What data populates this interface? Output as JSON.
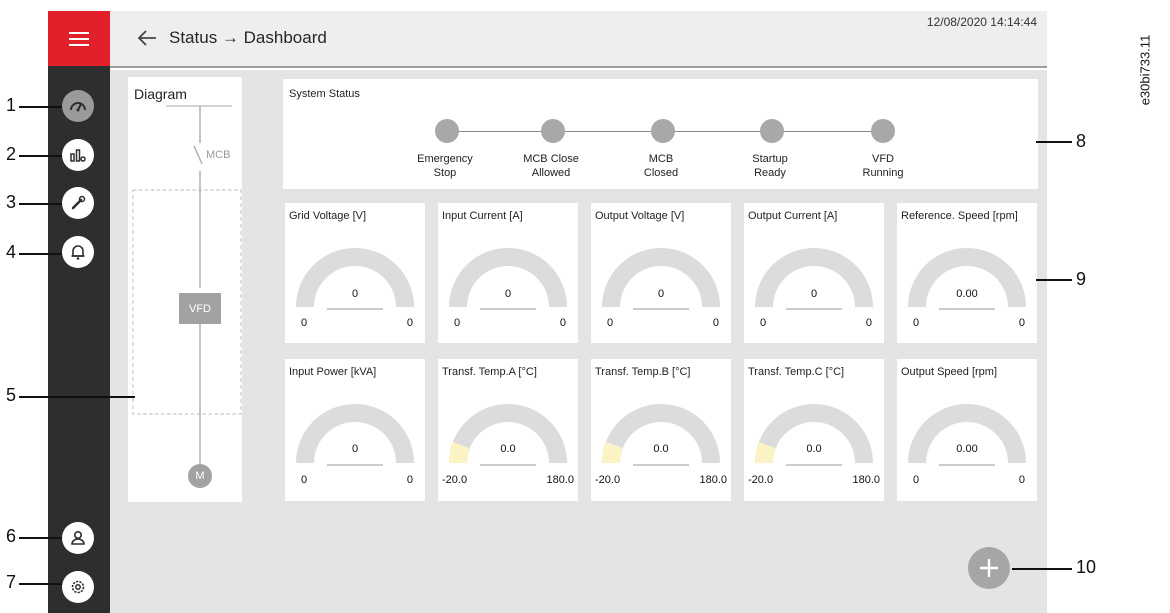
{
  "header": {
    "breadcrumb": "Status → Dashboard",
    "datetime": "12/08/2020 14:14:44"
  },
  "doc_id": "e30bi733.11",
  "sidebar": {
    "items": [
      {
        "name": "dashboard-icon",
        "active": true
      },
      {
        "name": "chart-icon",
        "active": false
      },
      {
        "name": "wrench-icon",
        "active": false
      },
      {
        "name": "bell-icon",
        "active": false
      },
      {
        "name": "user-icon",
        "active": false
      },
      {
        "name": "gear-icon",
        "active": false
      }
    ]
  },
  "diagram": {
    "title": "Diagram",
    "mcb_label": "MCB",
    "vfd_label": "VFD",
    "motor_label": "M"
  },
  "system_status": {
    "title": "System Status",
    "steps": [
      {
        "line1": "Emergency",
        "line2": "Stop"
      },
      {
        "line1": "MCB Close",
        "line2": "Allowed"
      },
      {
        "line1": "MCB",
        "line2": "Closed"
      },
      {
        "line1": "Startup",
        "line2": "Ready"
      },
      {
        "line1": "VFD",
        "line2": "Running"
      }
    ]
  },
  "gauges_row1": [
    {
      "title": "Grid Voltage [V]",
      "value": "0",
      "min": "0",
      "max": "0"
    },
    {
      "title": "Input Current [A]",
      "value": "0",
      "min": "0",
      "max": "0"
    },
    {
      "title": "Output Voltage [V]",
      "value": "0",
      "min": "0",
      "max": "0"
    },
    {
      "title": "Output Current [A]",
      "value": "0",
      "min": "0",
      "max": "0"
    },
    {
      "title": "Reference. Speed [rpm]",
      "value": "0.00",
      "min": "0",
      "max": "0"
    }
  ],
  "gauges_row2": [
    {
      "title": "Input Power [kVA]",
      "value": "0",
      "min": "0",
      "max": "0"
    },
    {
      "title": "Transf. Temp.A [°C]",
      "value": "0.0",
      "min": "-20.0",
      "max": "180.0"
    },
    {
      "title": "Transf. Temp.B [°C]",
      "value": "0.0",
      "min": "-20.0",
      "max": "180.0"
    },
    {
      "title": "Transf. Temp.C [°C]",
      "value": "0.0",
      "min": "-20.0",
      "max": "180.0"
    },
    {
      "title": "Output Speed [rpm]",
      "value": "0.00",
      "min": "0",
      "max": "0"
    }
  ],
  "callouts": [
    "1",
    "2",
    "3",
    "4",
    "5",
    "6",
    "7",
    "8",
    "9",
    "10"
  ],
  "colors": {
    "sidebar": "#2e2e30",
    "menu": "#e2202a",
    "accent_yellow": "#fbf3c4",
    "gauge_track": "#dcdcdc"
  }
}
